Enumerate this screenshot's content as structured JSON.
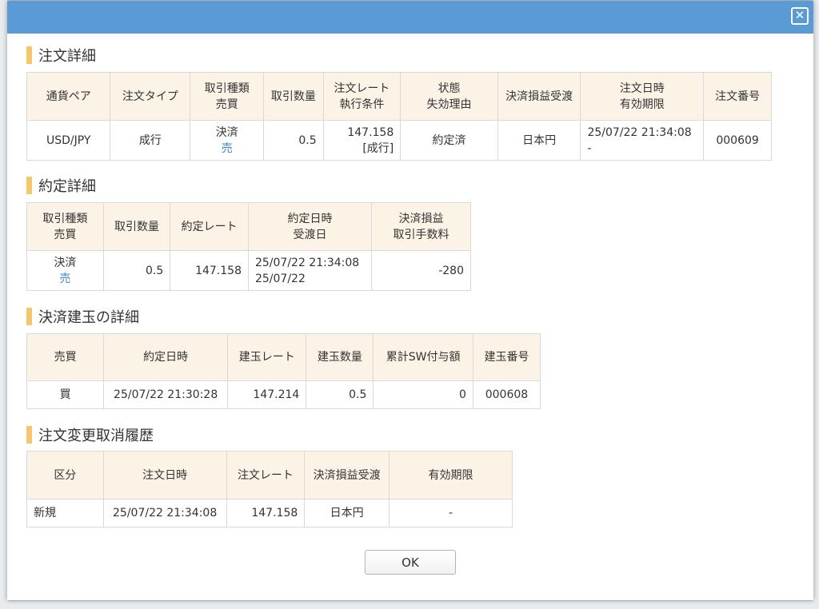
{
  "dialog": {
    "close_label": "✕",
    "ok_label": "OK"
  },
  "order_detail": {
    "title": "注文詳細",
    "headers": [
      [
        "通貨ペア"
      ],
      [
        "注文タイプ"
      ],
      [
        "取引種類",
        "売買"
      ],
      [
        "取引数量"
      ],
      [
        "注文レート",
        "執行条件"
      ],
      [
        "状態",
        "失効理由"
      ],
      [
        "決済損益受渡"
      ],
      [
        "注文日時",
        "有効期限"
      ],
      [
        "注文番号"
      ]
    ],
    "row": {
      "pair": "USD/JPY",
      "order_type": "成行",
      "trade_kind": "決済",
      "side": "売",
      "quantity": "0.5",
      "rate": "147.158",
      "condition": "[成行]",
      "status": "約定済",
      "settlement_currency": "日本円",
      "order_datetime": "25/07/22 21:34:08",
      "expiry": "-",
      "order_no": "000609"
    }
  },
  "execution_detail": {
    "title": "約定詳細",
    "headers": [
      [
        "取引種類",
        "売買"
      ],
      [
        "取引数量"
      ],
      [
        "約定レート"
      ],
      [
        "約定日時",
        "受渡日"
      ],
      [
        "決済損益",
        "取引手数料"
      ]
    ],
    "row": {
      "trade_kind": "決済",
      "side": "売",
      "quantity": "0.5",
      "rate": "147.158",
      "exec_datetime": "25/07/22 21:34:08",
      "delivery_date": "25/07/22",
      "pnl": "-280"
    }
  },
  "position_detail": {
    "title": "決済建玉の詳細",
    "headers": [
      "売買",
      "約定日時",
      "建玉レート",
      "建玉数量",
      "累計SW付与額",
      "建玉番号"
    ],
    "row": {
      "side": "買",
      "exec_datetime": "25/07/22 21:30:28",
      "rate": "147.214",
      "quantity": "0.5",
      "swap_total": "0",
      "position_no": "000608"
    }
  },
  "history": {
    "title": "注文変更取消履歴",
    "headers": [
      "区分",
      "注文日時",
      "注文レート",
      "決済損益受渡",
      "有効期限"
    ],
    "row": {
      "category": "新規",
      "order_datetime": "25/07/22 21:34:08",
      "rate": "147.158",
      "settlement_currency": "日本円",
      "expiry": "-"
    }
  },
  "colors": {
    "titlebar": "#5a9bd5",
    "section_bar": "#f6c66a",
    "header_bg": "#fbf3e6",
    "sell_blue": "#3f86c9",
    "buy_red": "#cc3333"
  }
}
